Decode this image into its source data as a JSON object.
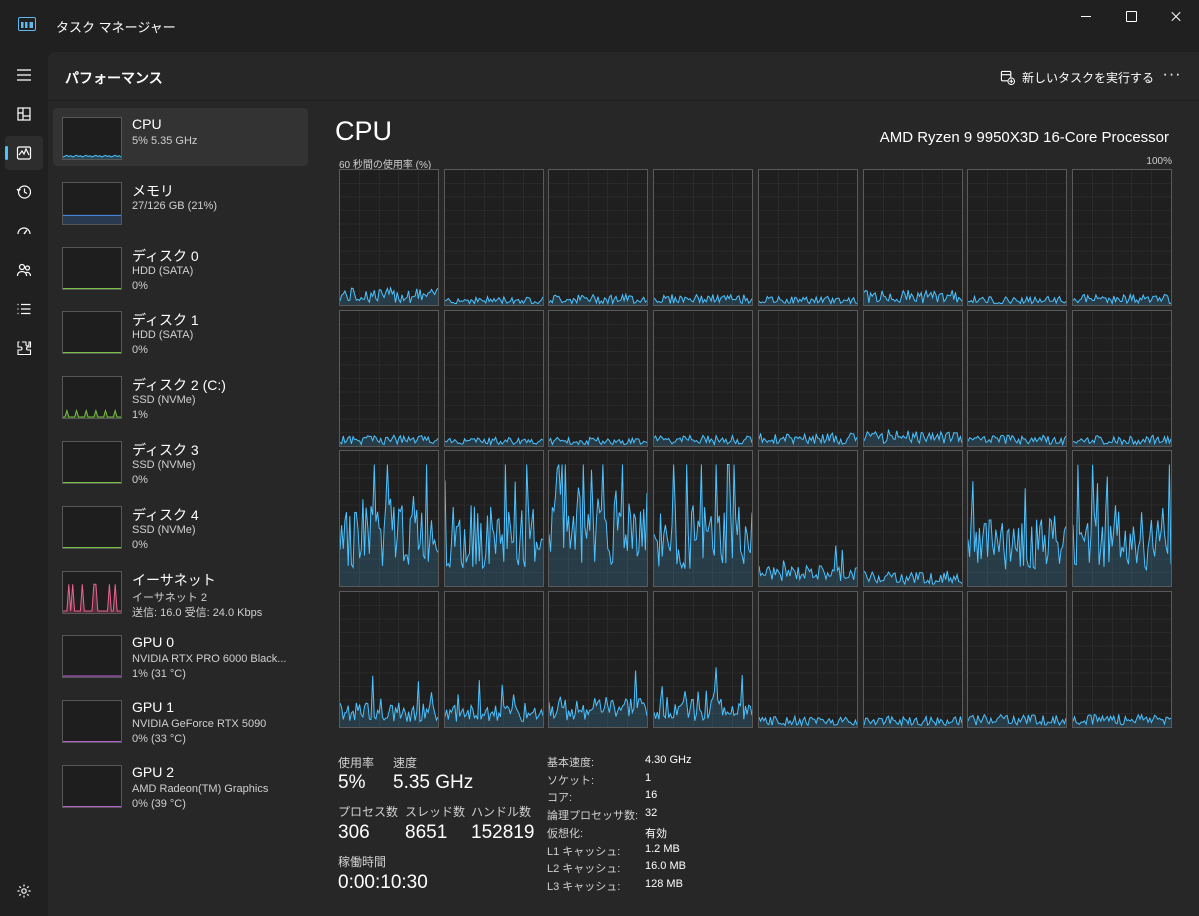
{
  "window": {
    "title": "タスク マネージャー"
  },
  "header": {
    "title": "パフォーマンス",
    "run_task_label": "新しいタスクを実行する",
    "more_label": "···"
  },
  "nav": {
    "items": [
      {
        "icon": "hamburger-menu-icon"
      },
      {
        "icon": "processes-icon"
      },
      {
        "icon": "performance-icon",
        "active": true
      },
      {
        "icon": "app-history-icon"
      },
      {
        "icon": "startup-apps-icon"
      },
      {
        "icon": "users-icon"
      },
      {
        "icon": "details-icon"
      },
      {
        "icon": "services-icon"
      },
      {
        "icon": "settings-icon"
      }
    ]
  },
  "devices": [
    {
      "name": "CPU",
      "sub1": "5%  5.35 GHz",
      "sub2": "",
      "color": "#4cc2ff",
      "level": 0.05
    },
    {
      "name": "メモリ",
      "sub1": "27/126 GB (21%)",
      "sub2": "",
      "color": "#4b8ce8",
      "level": 0.21
    },
    {
      "name": "ディスク 0",
      "sub1": "HDD (SATA)",
      "sub2": "0%",
      "color": "#7ac143",
      "level": 0
    },
    {
      "name": "ディスク 1",
      "sub1": "HDD (SATA)",
      "sub2": "0%",
      "color": "#7ac143",
      "level": 0
    },
    {
      "name": "ディスク 2 (C:)",
      "sub1": "SSD (NVMe)",
      "sub2": "1%",
      "color": "#7ac143",
      "level": 0.01
    },
    {
      "name": "ディスク 3",
      "sub1": "SSD (NVMe)",
      "sub2": "0%",
      "color": "#7ac143",
      "level": 0
    },
    {
      "name": "ディスク 4",
      "sub1": "SSD (NVMe)",
      "sub2": "0%",
      "color": "#7ac143",
      "level": 0
    },
    {
      "name": "イーサネット",
      "sub1": "イーサネット 2",
      "sub2": "送信: 16.0 受信: 24.0 Kbps",
      "color": "#e86491",
      "level": 0.3
    },
    {
      "name": "GPU 0",
      "sub1": "NVIDIA RTX PRO 6000 Black...",
      "sub2": "1%  (31 °C)",
      "color": "#b660d6",
      "level": 0.01
    },
    {
      "name": "GPU 1",
      "sub1": "NVIDIA GeForce RTX 5090",
      "sub2": "0%  (33 °C)",
      "color": "#b660d6",
      "level": 0
    },
    {
      "name": "GPU 2",
      "sub1": "AMD Radeon(TM) Graphics",
      "sub2": "0%  (39 °C)",
      "color": "#b660d6",
      "level": 0
    }
  ],
  "cpu": {
    "title": "CPU",
    "model": "AMD Ryzen 9 9950X3D 16-Core Processor",
    "graph_caption": "60 秒間の使用率 (%)",
    "graph_max": "100%",
    "line_color": "#4cc2ff",
    "core_count": 32
  },
  "stats": {
    "util_label": "使用率",
    "util_value": "5%",
    "speed_label": "速度",
    "speed_value": "5.35 GHz",
    "proc_label": "プロセス数",
    "proc_value": "306",
    "threads_label": "スレッド数",
    "threads_value": "8651",
    "handles_label": "ハンドル数",
    "handles_value": "152819",
    "uptime_label": "稼働時間",
    "uptime_value": "0:00:10:30"
  },
  "specs": [
    {
      "label": "基本速度:",
      "value": "4.30 GHz"
    },
    {
      "label": "ソケット:",
      "value": "1"
    },
    {
      "label": "コア:",
      "value": "16"
    },
    {
      "label": "論理プロセッサ数:",
      "value": "32"
    },
    {
      "label": "仮想化:",
      "value": "有効"
    },
    {
      "label": "L1 キャッシュ:",
      "value": "1.2 MB"
    },
    {
      "label": "L2 キャッシュ:",
      "value": "16.0 MB"
    },
    {
      "label": "L3 キャッシュ:",
      "value": "128 MB"
    }
  ]
}
